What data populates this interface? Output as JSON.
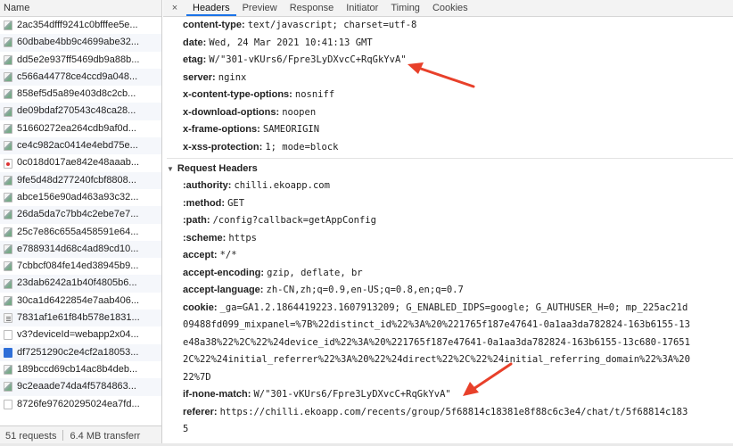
{
  "left": {
    "header": "Name",
    "requests": [
      {
        "name": "2ac354dfff9241c0bfffee5e...",
        "icon": "image-file-icon"
      },
      {
        "name": "60dbabe4bb9c4699abe32...",
        "icon": "image-file-icon"
      },
      {
        "name": "dd5e2e937ff5469db9a88b...",
        "icon": "image-file-icon"
      },
      {
        "name": "c566a44778ce4ccd9a048...",
        "icon": "image-file-icon"
      },
      {
        "name": "858ef5d5a89e403d8c2cb...",
        "icon": "image-file-icon"
      },
      {
        "name": "de09bdaf270543c48ca28...",
        "icon": "image-file-icon"
      },
      {
        "name": "51660272ea264cdb9af0d...",
        "icon": "image-file-icon"
      },
      {
        "name": "ce4c982ac0414e4ebd75e...",
        "icon": "image-file-icon"
      },
      {
        "name": "0c018d017ae842e48aaab...",
        "icon": "xhr-icon"
      },
      {
        "name": "9fe5d48d277240fcbf8808...",
        "icon": "image-file-icon"
      },
      {
        "name": "abce156e90ad463a93c32...",
        "icon": "image-file-icon"
      },
      {
        "name": "26da5da7c7bb4c2ebe7e7...",
        "icon": "image-file-icon"
      },
      {
        "name": "25c7e86c655a458591e64...",
        "icon": "image-file-icon"
      },
      {
        "name": "e7889314d68c4ad89cd10...",
        "icon": "image-file-icon"
      },
      {
        "name": "7cbbcf084fe14ed38945b9...",
        "icon": "image-file-icon"
      },
      {
        "name": "23dab6242a1b40f4805b6...",
        "icon": "image-file-icon"
      },
      {
        "name": "30ca1d6422854e7aab406...",
        "icon": "image-file-icon"
      },
      {
        "name": "7831af1e61f84b578e1831...",
        "icon": "script-file-icon"
      },
      {
        "name": "v3?deviceId=webapp2x04...",
        "icon": "document-file-icon"
      },
      {
        "name": "df7251290c2e4cf2a18053...",
        "icon": "blue-file-icon"
      },
      {
        "name": "189bccd69cb14ac8b4deb...",
        "icon": "image-file-icon"
      },
      {
        "name": "9c2eaade74da4f5784863...",
        "icon": "image-file-icon"
      },
      {
        "name": "8726fe97620295024ea7fd...",
        "icon": "document-file-icon"
      }
    ],
    "footer": {
      "requests": "51 requests",
      "transferred": "6.4 MB transferr"
    }
  },
  "tabs": {
    "close": "×",
    "items": [
      "Headers",
      "Preview",
      "Response",
      "Initiator",
      "Timing",
      "Cookies"
    ],
    "active": "Headers"
  },
  "response_headers": [
    {
      "k": "content-type:",
      "v": "text/javascript; charset=utf-8"
    },
    {
      "k": "date:",
      "v": "Wed, 24 Mar 2021 10:41:13 GMT"
    },
    {
      "k": "etag:",
      "v": "W/\"301-vKUrs6/Fpre3LyDXvcC+RqGkYvA\""
    },
    {
      "k": "server:",
      "v": "nginx"
    },
    {
      "k": "x-content-type-options:",
      "v": "nosniff"
    },
    {
      "k": "x-download-options:",
      "v": "noopen"
    },
    {
      "k": "x-frame-options:",
      "v": "SAMEORIGIN"
    },
    {
      "k": "x-xss-protection:",
      "v": "1; mode=block"
    }
  ],
  "request_section": {
    "triangle": "▼",
    "title": "Request Headers"
  },
  "request_headers": [
    {
      "k": ":authority:",
      "v": "chilli.ekoapp.com"
    },
    {
      "k": ":method:",
      "v": "GET"
    },
    {
      "k": ":path:",
      "v": "/config?callback=getAppConfig"
    },
    {
      "k": ":scheme:",
      "v": "https"
    },
    {
      "k": "accept:",
      "v": "*/*"
    },
    {
      "k": "accept-encoding:",
      "v": "gzip, deflate, br"
    },
    {
      "k": "accept-language:",
      "v": "zh-CN,zh;q=0.9,en-US;q=0.8,en;q=0.7"
    },
    {
      "k": "cookie:",
      "v": "_ga=GA1.2.1864419223.1607913209; G_ENABLED_IDPS=google; G_AUTHUSER_H=0; mp_225ac21d"
    }
  ],
  "cookie_continuation": [
    "09488fd099_mixpanel=%7B%22distinct_id%22%3A%20%221765f187e47641-0a1aa3da782824-163b6155-13",
    "e48a38%22%2C%22%24device_id%22%3A%20%221765f187e47641-0a1aa3da782824-163b6155-13c680-17651",
    "2C%22%24initial_referrer%22%3A%20%22%24direct%22%2C%22%24initial_referring_domain%22%3A%20",
    "22%7D"
  ],
  "request_headers_tail": [
    {
      "k": "if-none-match:",
      "v": "W/\"301-vKUrs6/Fpre3LyDXvcC+RqGkYvA\""
    },
    {
      "k": "referer:",
      "v": "https://chilli.ekoapp.com/recents/group/5f68814c18381e8f88c6c3e4/chat/t/5f68814c183"
    }
  ],
  "referer_continuation": "5",
  "colors": {
    "annotation_arrow": "#e8402a",
    "active_tab_underline": "#1a73e8"
  }
}
